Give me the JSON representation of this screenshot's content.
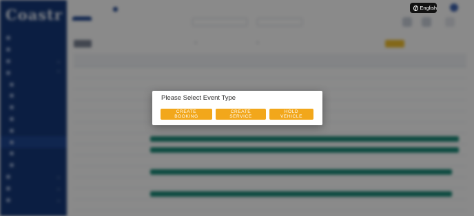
{
  "language": {
    "label": "English",
    "icon": "globe-icon"
  },
  "modal": {
    "title": "Please Select Event Type",
    "buttons": [
      {
        "label": "Create Booking",
        "id": "create-booking"
      },
      {
        "label": "Create Service",
        "id": "create-service"
      },
      {
        "label": "Hold Vehicle",
        "id": "hold-vehicle"
      }
    ],
    "button_color": "#f2a71b"
  },
  "colors": {
    "sidebar": "#16397a",
    "accent": "#f2c12e",
    "event_bar": "#188a78"
  }
}
